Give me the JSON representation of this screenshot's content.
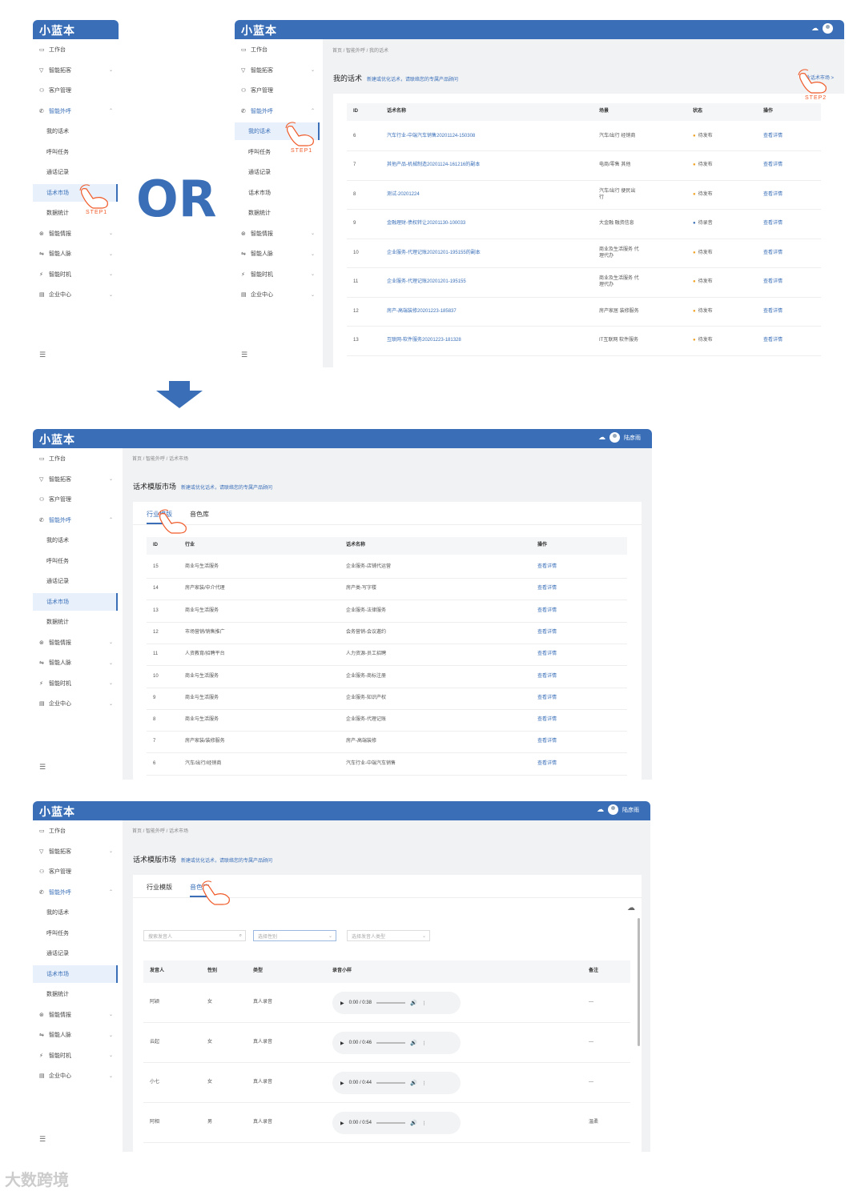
{
  "app": {
    "logo": "小蓝本",
    "user": "陆彦雨"
  },
  "menu": [
    "工作台",
    "智能拓客",
    "客户管理",
    "智能外呼",
    "我的话术",
    "呼叫任务",
    "通话记录",
    "话术市场",
    "数据统计",
    "智能情报",
    "智能人脉",
    "智能时机",
    "企业中心"
  ],
  "steps": {
    "s1": "STEP1",
    "s2": "STEP2"
  },
  "or_text": "OR",
  "p1": {
    "crumb": "首页 / 智能外呼 / 我的话术",
    "title": "我的话术",
    "hint": "新建或优化话术，请联络您的专属产品顾问",
    "link": "行业话术市场 >",
    "headers": [
      "ID",
      "话术名称",
      "场景",
      "状态",
      "操作"
    ],
    "rows": [
      {
        "id": "6",
        "name": "汽车行业-中端汽车销售20201124-150308",
        "scene": "汽车/出行 经销商",
        "status": "待发布",
        "op": "查看详情"
      },
      {
        "id": "7",
        "name": "其他产品-机械制造20201124-161216的副本",
        "scene": "电商/零售 其他",
        "status": "待发布",
        "op": "查看详情"
      },
      {
        "id": "8",
        "name": "测试-20201224",
        "scene": "汽车/出行 便民出行",
        "status": "待发布",
        "op": "查看详情"
      },
      {
        "id": "9",
        "name": "金融理财-债权转让20201130-100033",
        "scene": "大金融 融资信息",
        "status": "待录音",
        "op": "查看详情"
      },
      {
        "id": "10",
        "name": "企业服务-代理记账20201201-195155的副本",
        "scene": "商业及生活服务 代理代办",
        "status": "待发布",
        "op": "查看详情"
      },
      {
        "id": "11",
        "name": "企业服务-代理记账20201201-195155",
        "scene": "商业及生活服务 代理代办",
        "status": "待发布",
        "op": "查看详情"
      },
      {
        "id": "12",
        "name": "房产-高端装修20201223-185837",
        "scene": "房产家居 装修服务",
        "status": "待发布",
        "op": "查看详情"
      },
      {
        "id": "13",
        "name": "互联网-软件服务20201223-181328",
        "scene": "IT互联网 软件服务",
        "status": "待发布",
        "op": "查看详情"
      }
    ]
  },
  "p2": {
    "crumb": "首页 / 智能外呼 / 话术市场",
    "title": "话术模版市场",
    "hint": "新建或优化话术，请联络您的专属产品顾问",
    "tabs": [
      "行业模版",
      "音色库"
    ],
    "headers": [
      "ID",
      "行业",
      "话术名称",
      "操作"
    ],
    "rows": [
      {
        "id": "15",
        "ind": "商业与生活服务",
        "name": "企业服务-店铺代运营",
        "op": "查看详情"
      },
      {
        "id": "14",
        "ind": "房产家装/中介代理",
        "name": "房产类-写字楼",
        "op": "查看详情"
      },
      {
        "id": "13",
        "ind": "商业与生活服务",
        "name": "企业服务-法律服务",
        "op": "查看详情"
      },
      {
        "id": "12",
        "ind": "市场营销/销售推广",
        "name": "会务营销-会议邀约",
        "op": "查看详情"
      },
      {
        "id": "11",
        "ind": "人资教育/招聘平台",
        "name": "人力资源-员工招聘",
        "op": "查看详情"
      },
      {
        "id": "10",
        "ind": "商业与生活服务",
        "name": "企业服务-商标注册",
        "op": "查看详情"
      },
      {
        "id": "9",
        "ind": "商业与生活服务",
        "name": "企业服务-知识产权",
        "op": "查看详情"
      },
      {
        "id": "8",
        "ind": "商业与生活服务",
        "name": "企业服务-代理记账",
        "op": "查看详情"
      },
      {
        "id": "7",
        "ind": "房产家装/装修服务",
        "name": "房产-高端装修",
        "op": "查看详情"
      },
      {
        "id": "6",
        "ind": "汽车/出行/经销商",
        "name": "汽车行业-中端汽车销售",
        "op": "查看详情"
      }
    ]
  },
  "p3": {
    "crumb": "首页 / 智能外呼 / 话术市场",
    "title": "话术模版市场",
    "hint": "新建或优化话术，请联络您的专属产品顾问",
    "tabs": [
      "行业模版",
      "音色库"
    ],
    "search_ph": "搜索发音人",
    "gender_ph": "选择性别",
    "type_ph": "选择发音人类型",
    "headers": [
      "发音人",
      "性别",
      "类型",
      "录音小样",
      "备注"
    ],
    "rows": [
      {
        "name": "阿颖",
        "gender": "女",
        "type": "真人录音",
        "time": "0:00 / 0:38",
        "note": "---"
      },
      {
        "name": "云起",
        "gender": "女",
        "type": "真人录音",
        "time": "0:00 / 0:46",
        "note": "---"
      },
      {
        "name": "小七",
        "gender": "女",
        "type": "真人录音",
        "time": "0:00 / 0:44",
        "note": "---"
      },
      {
        "name": "阿相",
        "gender": "男",
        "type": "真人录音",
        "time": "0:00 / 0:54",
        "note": "温柔"
      }
    ]
  },
  "watermark": "大数跨境"
}
